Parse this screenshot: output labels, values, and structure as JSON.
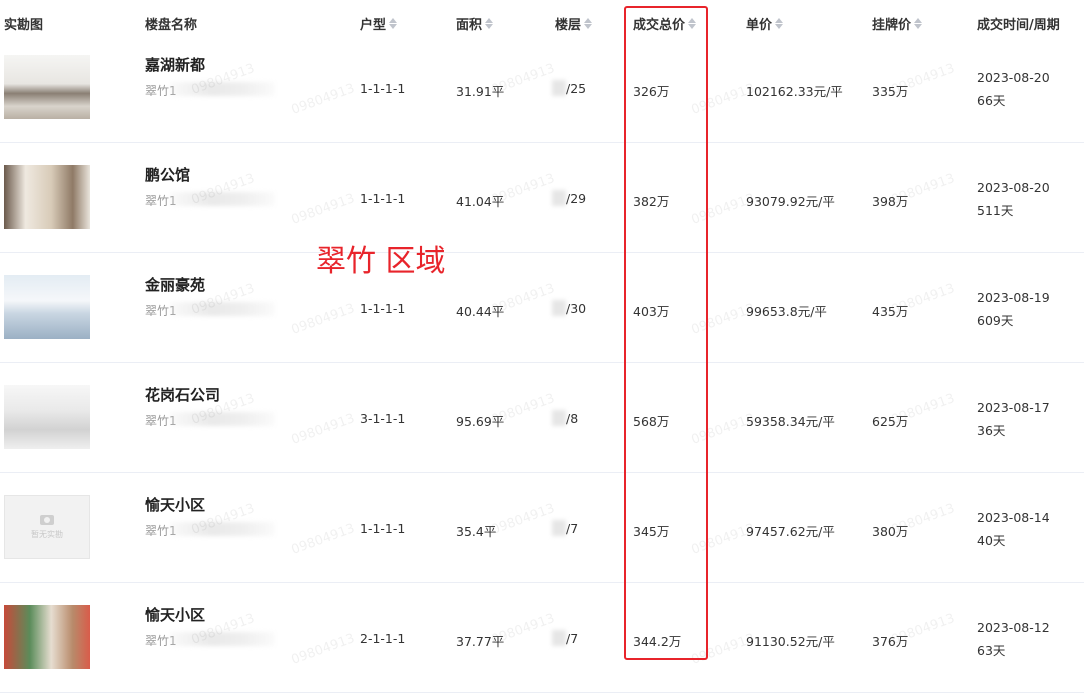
{
  "header": {
    "photo": "实勘图",
    "name": "楼盘名称",
    "layout": "户型",
    "area": "面积",
    "floor": "楼层",
    "total": "成交总价",
    "unit": "单价",
    "listing": "挂牌价",
    "deal_time": "成交时间/周期"
  },
  "annotation": "翠竹 区域",
  "watermark": "09804913",
  "no_photo_text": "暂无实勘",
  "rows": [
    {
      "name": "嘉湖新都",
      "sub": "翠竹1",
      "layout": "1-1-1-1",
      "area": "31.91平",
      "floor": "/25",
      "total": "326万",
      "unit": "102162.33元/平",
      "listing": "335万",
      "date": "2023-08-20",
      "cycle": "66天"
    },
    {
      "name": "鹏公馆",
      "sub": "翠竹1",
      "layout": "1-1-1-1",
      "area": "41.04平",
      "floor": "/29",
      "total": "382万",
      "unit": "93079.92元/平",
      "listing": "398万",
      "date": "2023-08-20",
      "cycle": "511天"
    },
    {
      "name": "金丽豪苑",
      "sub": "翠竹1",
      "layout": "1-1-1-1",
      "area": "40.44平",
      "floor": "/30",
      "total": "403万",
      "unit": "99653.8元/平",
      "listing": "435万",
      "date": "2023-08-19",
      "cycle": "609天"
    },
    {
      "name": "花岗石公司",
      "sub": "翠竹1",
      "layout": "3-1-1-1",
      "area": "95.69平",
      "floor": "/8",
      "total": "568万",
      "unit": "59358.34元/平",
      "listing": "625万",
      "date": "2023-08-17",
      "cycle": "36天"
    },
    {
      "name": "愉天小区",
      "sub": "翠竹1",
      "layout": "1-1-1-1",
      "area": "35.4平",
      "floor": "/7",
      "total": "345万",
      "unit": "97457.62元/平",
      "listing": "380万",
      "date": "2023-08-14",
      "cycle": "40天"
    },
    {
      "name": "愉天小区",
      "sub": "翠竹1",
      "layout": "2-1-1-1",
      "area": "37.77平",
      "floor": "/7",
      "total": "344.2万",
      "unit": "91130.52元/平",
      "listing": "376万",
      "date": "2023-08-12",
      "cycle": "63天"
    }
  ]
}
